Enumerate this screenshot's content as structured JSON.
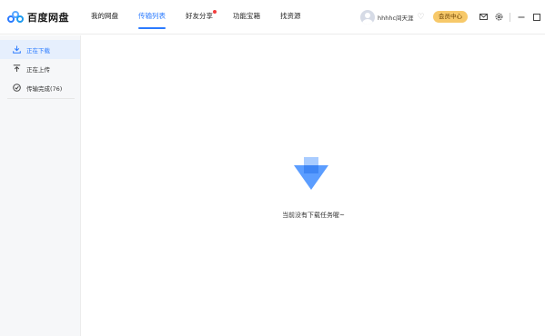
{
  "app": {
    "logo_text": "百度网盘"
  },
  "nav": {
    "items": [
      {
        "label": "我的网盘"
      },
      {
        "label": "传输列表"
      },
      {
        "label": "好友分享"
      },
      {
        "label": "功能宝箱"
      },
      {
        "label": "找资源"
      }
    ],
    "active_index": 1
  },
  "user": {
    "name": "hhhhc间天涯",
    "vip_label": "会员中心"
  },
  "sidebar": {
    "items": [
      {
        "label": "正在下载"
      },
      {
        "label": "正在上传"
      },
      {
        "label": "传输完成(76)"
      }
    ]
  },
  "main": {
    "empty_message": "当前没有下载任务喔~"
  },
  "colors": {
    "accent": "#2b7bff",
    "vip": "#f7c96a",
    "notify_dot": "#f23d3d"
  }
}
